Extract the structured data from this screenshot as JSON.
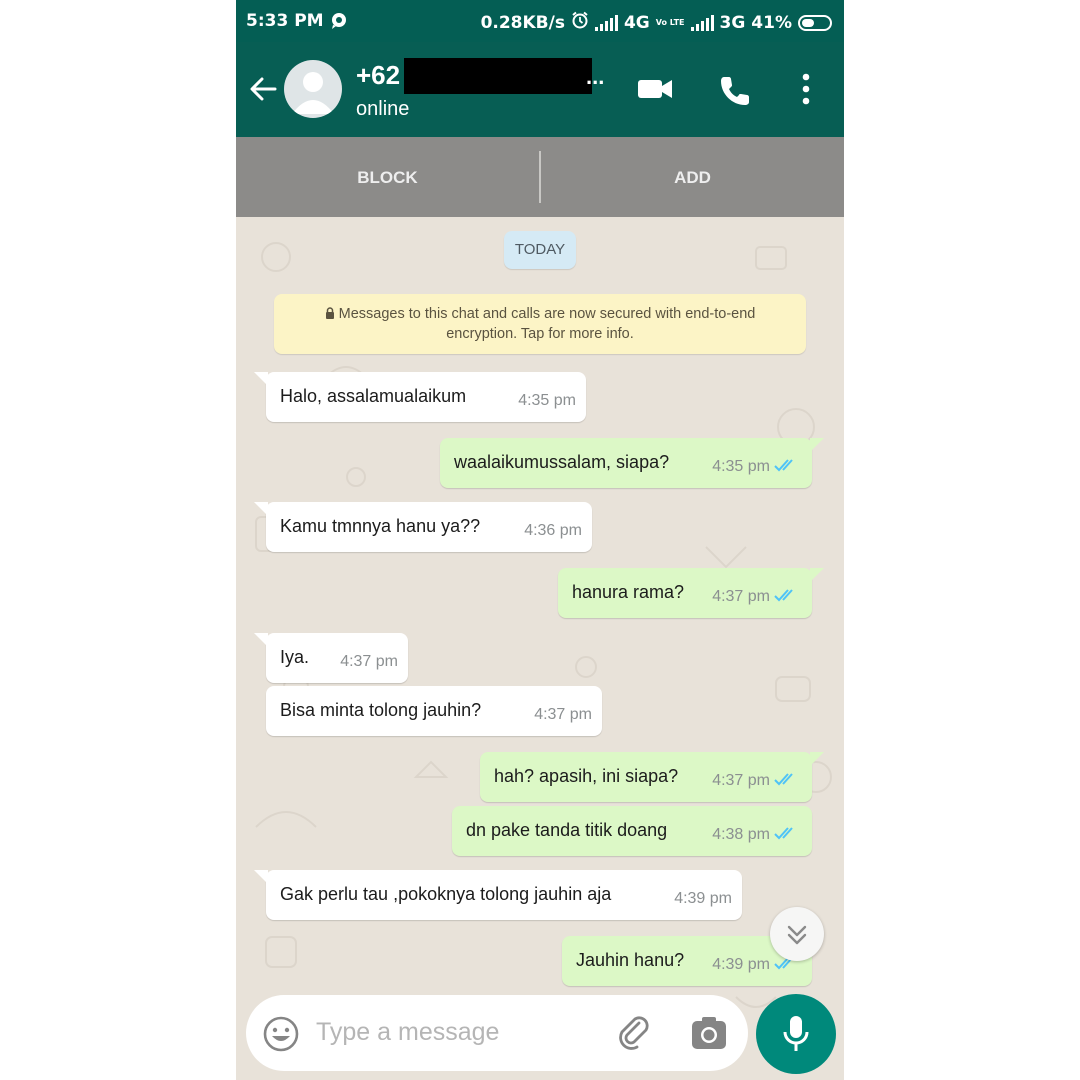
{
  "status_bar": {
    "time": "5:33 PM",
    "speed": "0.28KB/s",
    "net1": "4G",
    "volte": "Vo LTE",
    "net2": "3G",
    "battery": "41%"
  },
  "header": {
    "contact_prefix": "+62",
    "contact_redacted_tail": "...",
    "status": "online",
    "icons": [
      "back-arrow-icon",
      "video-call-icon",
      "phone-icon",
      "more-vert-icon"
    ]
  },
  "actions": {
    "block": "BLOCK",
    "add": "ADD"
  },
  "chat": {
    "date_chip": "TODAY",
    "encryption_notice": "Messages to this chat and calls are now secured with end-to-end encryption. Tap for more info.",
    "messages": [
      {
        "dir": "in",
        "text": "Halo, assalamualaikum",
        "time": "4:35 pm"
      },
      {
        "dir": "out",
        "text": "waalaikumussalam, siapa?",
        "time": "4:35 pm",
        "read": true
      },
      {
        "dir": "in",
        "text": "Kamu tmnnya hanu ya??",
        "time": "4:36 pm"
      },
      {
        "dir": "out",
        "text": "hanura rama?",
        "time": "4:37 pm",
        "read": true
      },
      {
        "dir": "in",
        "text": "Iya.",
        "time": "4:37 pm"
      },
      {
        "dir": "in",
        "text": "Bisa minta tolong jauhin?",
        "time": "4:37 pm"
      },
      {
        "dir": "out",
        "text": "hah? apasih, ini siapa?",
        "time": "4:37 pm",
        "read": true
      },
      {
        "dir": "out",
        "text": "dn pake tanda titik doang",
        "time": "4:38 pm",
        "read": true
      },
      {
        "dir": "in",
        "text": "Gak perlu tau ,pokoknya tolong jauhin aja",
        "time": "4:39 pm"
      },
      {
        "dir": "out",
        "text": "Jauhin hanu?",
        "time": "4:39 pm",
        "read": true
      }
    ]
  },
  "input": {
    "placeholder": "Type a message",
    "value": ""
  },
  "colors": {
    "header": "#075e54",
    "status_bar": "#045e54",
    "accent": "#00897b",
    "outgoing_bubble": "#dcf8c6",
    "incoming_bubble": "#ffffff",
    "read_ticks": "#4fc3f7"
  }
}
